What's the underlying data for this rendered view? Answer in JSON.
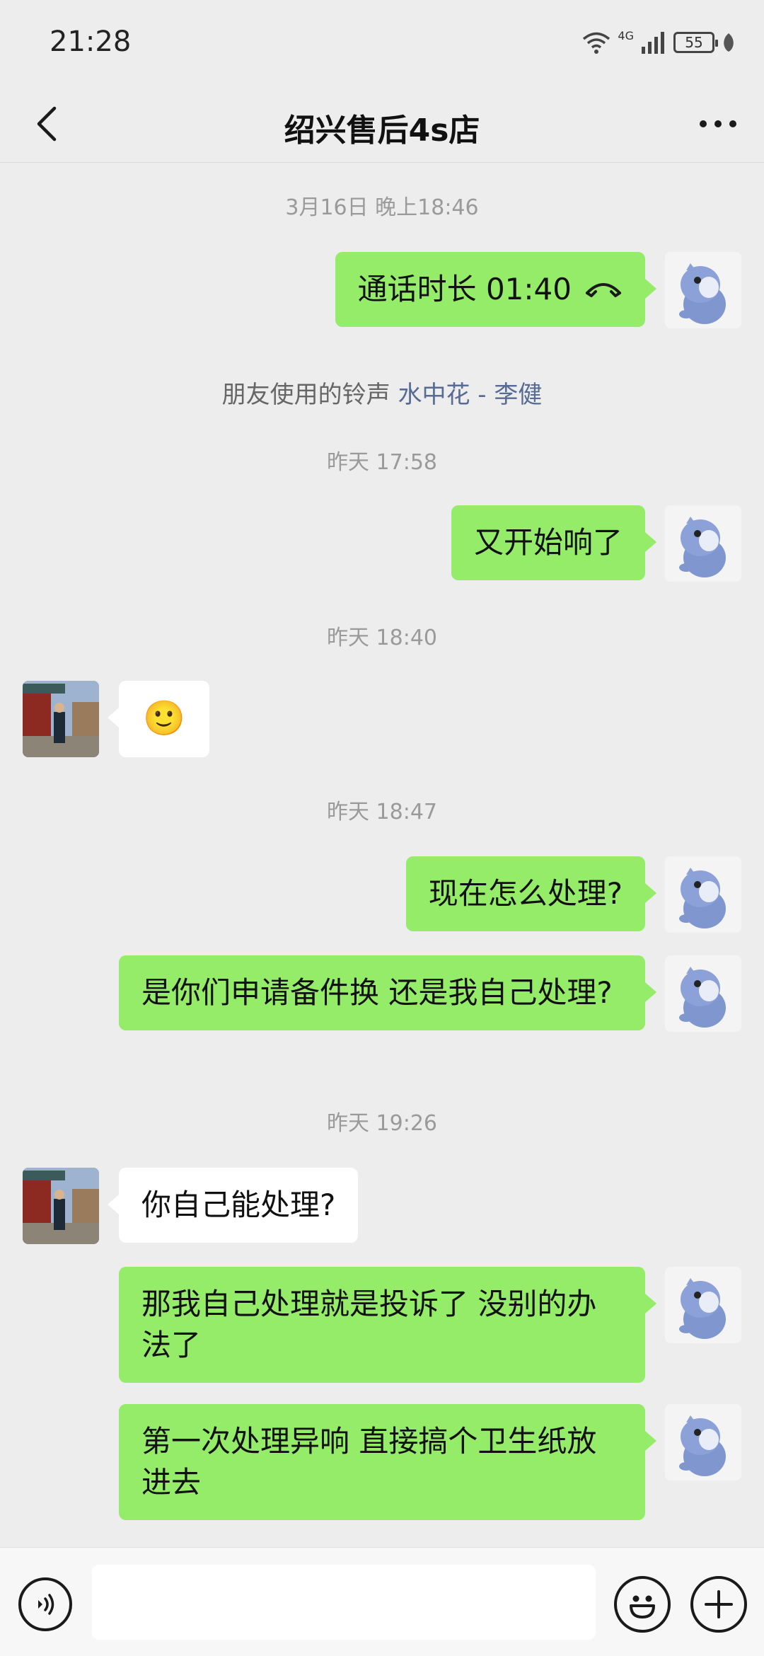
{
  "status_bar": {
    "time": "21:28",
    "network": "4G",
    "battery": "55"
  },
  "header": {
    "title": "绍兴售后4s店"
  },
  "chat": {
    "timestamps": [
      "3月16日 晚上18:46",
      "昨天 17:58",
      "昨天 18:40",
      "昨天 18:47",
      "昨天 19:26"
    ],
    "call": {
      "label": "通话时长 01:40"
    },
    "ringtone": {
      "prefix": "朋友使用的铃声",
      "song": "水中花 - 李健"
    },
    "messages": [
      {
        "from": "me",
        "text": "又开始响了"
      },
      {
        "from": "other",
        "text": "🙂"
      },
      {
        "from": "me",
        "text": "现在怎么处理?"
      },
      {
        "from": "me",
        "text": "是你们申请备件换 还是我自己处理?"
      },
      {
        "from": "other",
        "text": "你自己能处理?"
      },
      {
        "from": "me",
        "text": "那我自己处理就是投诉了 没别的办法了"
      },
      {
        "from": "me",
        "text": "第一次处理异响 直接搞个卫生纸放进去"
      }
    ]
  },
  "input_bar": {
    "placeholder": ""
  },
  "colors": {
    "my_bubble": "#95ec69",
    "their_bubble": "#ffffff",
    "background": "#ededed",
    "link": "#576b95"
  }
}
